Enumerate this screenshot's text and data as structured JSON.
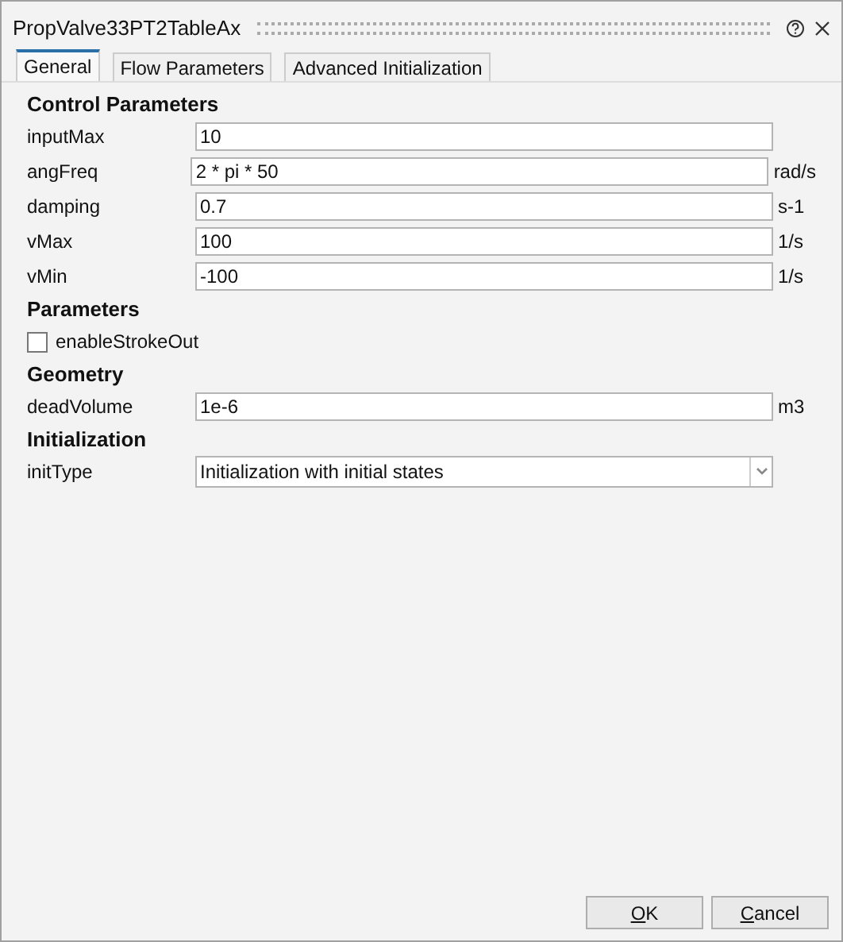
{
  "window": {
    "title": "PropValve33PT2TableAx"
  },
  "tabs": [
    {
      "label": "General",
      "selected": true
    },
    {
      "label": "Flow Parameters",
      "selected": false
    },
    {
      "label": "Advanced Initialization",
      "selected": false
    }
  ],
  "rows": [
    {
      "kind": "section",
      "label": "Control Parameters"
    },
    {
      "kind": "field",
      "label": "inputMax",
      "value": "10"
    },
    {
      "kind": "field",
      "label": "angFreq",
      "value": "2 * pi * 50",
      "unit": "rad/s"
    },
    {
      "kind": "field",
      "label": "damping",
      "value": "0.7",
      "unit": "s-1"
    },
    {
      "kind": "field",
      "label": "vMax",
      "value": "100",
      "unit": "1/s"
    },
    {
      "kind": "field",
      "label": "vMin",
      "value": "-100",
      "unit": "1/s"
    },
    {
      "kind": "section",
      "label": "Parameters"
    },
    {
      "kind": "checkbox",
      "label": "enableStrokeOut",
      "checked": false
    },
    {
      "kind": "section",
      "label": "Geometry"
    },
    {
      "kind": "field",
      "label": "deadVolume",
      "value": "1e-6",
      "unit": "m3"
    },
    {
      "kind": "section",
      "label": "Initialization"
    },
    {
      "kind": "dropdown",
      "label": "initType",
      "value": "Initialization with initial states"
    }
  ],
  "buttons": [
    {
      "label": "OK"
    },
    {
      "label": "Cancel"
    }
  ]
}
